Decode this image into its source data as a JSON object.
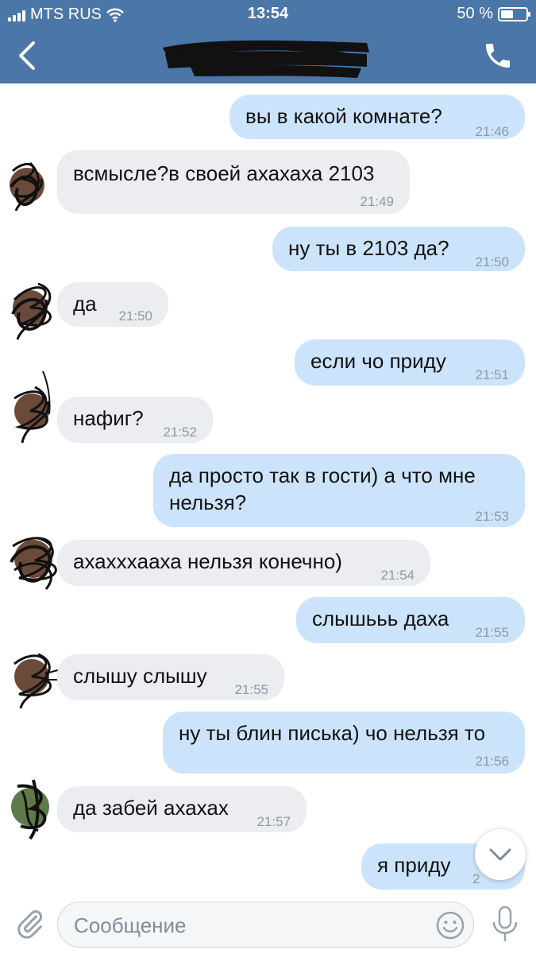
{
  "status_bar": {
    "carrier": "MTS RUS",
    "time": "13:54",
    "battery": "50 %",
    "battery_level": 0.5
  },
  "header": {
    "back_icon": "chevron-left-icon",
    "call_icon": "phone-icon"
  },
  "messages": [
    {
      "dir": "out",
      "text": "вы в какой комнате?",
      "time": "21:46"
    },
    {
      "dir": "in",
      "text": "всмысле?в своей ахахаха 2103",
      "time": "21:49"
    },
    {
      "dir": "out",
      "text": "ну ты в 2103 да?",
      "time": "21:50"
    },
    {
      "dir": "in",
      "text": "да",
      "time": "21:50"
    },
    {
      "dir": "out",
      "text": "если чо приду",
      "time": "21:51"
    },
    {
      "dir": "in",
      "text": "нафиг?",
      "time": "21:52"
    },
    {
      "dir": "out",
      "text_line1": "да просто так в гости) а что мне",
      "text_line2": "нельзя?",
      "time": "21:53"
    },
    {
      "dir": "in",
      "text": "ахаххxааха нельзя конечно)",
      "time": "21:54"
    },
    {
      "dir": "out",
      "text": "слышььь даха",
      "time": "21:55"
    },
    {
      "dir": "in",
      "text": "слышу слышу",
      "time": "21:55"
    },
    {
      "dir": "out",
      "text": "ну ты блин писька) чо нельзя то",
      "time": "21:56"
    },
    {
      "dir": "in",
      "text": "да забей ахахах",
      "time": "21:57"
    },
    {
      "dir": "out",
      "text": "я приду",
      "time": "2"
    }
  ],
  "composer": {
    "placeholder": "Сообщение",
    "attach_icon": "paperclip-icon",
    "emoji_icon": "smiley-icon",
    "mic_icon": "microphone-icon"
  },
  "scroll_down_icon": "chevron-down-icon",
  "colors": {
    "header": "#4a76a8",
    "bubble_out": "#cce4fb",
    "bubble_in": "#ebedf0",
    "timestamp": "#8e99a6"
  }
}
